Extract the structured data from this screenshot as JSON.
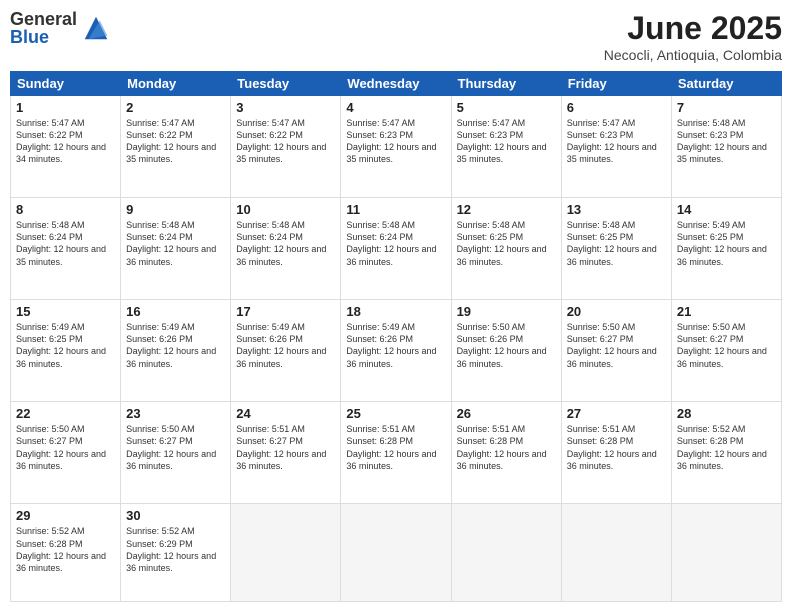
{
  "header": {
    "logo_general": "General",
    "logo_blue": "Blue",
    "month_title": "June 2025",
    "location": "Necocli, Antioquia, Colombia"
  },
  "days_of_week": [
    "Sunday",
    "Monday",
    "Tuesday",
    "Wednesday",
    "Thursday",
    "Friday",
    "Saturday"
  ],
  "weeks": [
    [
      {
        "day": 1,
        "sunrise": "5:47 AM",
        "sunset": "6:22 PM",
        "daylight": "12 hours and 34 minutes."
      },
      {
        "day": 2,
        "sunrise": "5:47 AM",
        "sunset": "6:22 PM",
        "daylight": "12 hours and 35 minutes."
      },
      {
        "day": 3,
        "sunrise": "5:47 AM",
        "sunset": "6:22 PM",
        "daylight": "12 hours and 35 minutes."
      },
      {
        "day": 4,
        "sunrise": "5:47 AM",
        "sunset": "6:23 PM",
        "daylight": "12 hours and 35 minutes."
      },
      {
        "day": 5,
        "sunrise": "5:47 AM",
        "sunset": "6:23 PM",
        "daylight": "12 hours and 35 minutes."
      },
      {
        "day": 6,
        "sunrise": "5:47 AM",
        "sunset": "6:23 PM",
        "daylight": "12 hours and 35 minutes."
      },
      {
        "day": 7,
        "sunrise": "5:48 AM",
        "sunset": "6:23 PM",
        "daylight": "12 hours and 35 minutes."
      }
    ],
    [
      {
        "day": 8,
        "sunrise": "5:48 AM",
        "sunset": "6:24 PM",
        "daylight": "12 hours and 35 minutes."
      },
      {
        "day": 9,
        "sunrise": "5:48 AM",
        "sunset": "6:24 PM",
        "daylight": "12 hours and 36 minutes."
      },
      {
        "day": 10,
        "sunrise": "5:48 AM",
        "sunset": "6:24 PM",
        "daylight": "12 hours and 36 minutes."
      },
      {
        "day": 11,
        "sunrise": "5:48 AM",
        "sunset": "6:24 PM",
        "daylight": "12 hours and 36 minutes."
      },
      {
        "day": 12,
        "sunrise": "5:48 AM",
        "sunset": "6:25 PM",
        "daylight": "12 hours and 36 minutes."
      },
      {
        "day": 13,
        "sunrise": "5:48 AM",
        "sunset": "6:25 PM",
        "daylight": "12 hours and 36 minutes."
      },
      {
        "day": 14,
        "sunrise": "5:49 AM",
        "sunset": "6:25 PM",
        "daylight": "12 hours and 36 minutes."
      }
    ],
    [
      {
        "day": 15,
        "sunrise": "5:49 AM",
        "sunset": "6:25 PM",
        "daylight": "12 hours and 36 minutes."
      },
      {
        "day": 16,
        "sunrise": "5:49 AM",
        "sunset": "6:26 PM",
        "daylight": "12 hours and 36 minutes."
      },
      {
        "day": 17,
        "sunrise": "5:49 AM",
        "sunset": "6:26 PM",
        "daylight": "12 hours and 36 minutes."
      },
      {
        "day": 18,
        "sunrise": "5:49 AM",
        "sunset": "6:26 PM",
        "daylight": "12 hours and 36 minutes."
      },
      {
        "day": 19,
        "sunrise": "5:50 AM",
        "sunset": "6:26 PM",
        "daylight": "12 hours and 36 minutes."
      },
      {
        "day": 20,
        "sunrise": "5:50 AM",
        "sunset": "6:27 PM",
        "daylight": "12 hours and 36 minutes."
      },
      {
        "day": 21,
        "sunrise": "5:50 AM",
        "sunset": "6:27 PM",
        "daylight": "12 hours and 36 minutes."
      }
    ],
    [
      {
        "day": 22,
        "sunrise": "5:50 AM",
        "sunset": "6:27 PM",
        "daylight": "12 hours and 36 minutes."
      },
      {
        "day": 23,
        "sunrise": "5:50 AM",
        "sunset": "6:27 PM",
        "daylight": "12 hours and 36 minutes."
      },
      {
        "day": 24,
        "sunrise": "5:51 AM",
        "sunset": "6:27 PM",
        "daylight": "12 hours and 36 minutes."
      },
      {
        "day": 25,
        "sunrise": "5:51 AM",
        "sunset": "6:28 PM",
        "daylight": "12 hours and 36 minutes."
      },
      {
        "day": 26,
        "sunrise": "5:51 AM",
        "sunset": "6:28 PM",
        "daylight": "12 hours and 36 minutes."
      },
      {
        "day": 27,
        "sunrise": "5:51 AM",
        "sunset": "6:28 PM",
        "daylight": "12 hours and 36 minutes."
      },
      {
        "day": 28,
        "sunrise": "5:52 AM",
        "sunset": "6:28 PM",
        "daylight": "12 hours and 36 minutes."
      }
    ],
    [
      {
        "day": 29,
        "sunrise": "5:52 AM",
        "sunset": "6:28 PM",
        "daylight": "12 hours and 36 minutes."
      },
      {
        "day": 30,
        "sunrise": "5:52 AM",
        "sunset": "6:29 PM",
        "daylight": "12 hours and 36 minutes."
      },
      null,
      null,
      null,
      null,
      null
    ]
  ]
}
